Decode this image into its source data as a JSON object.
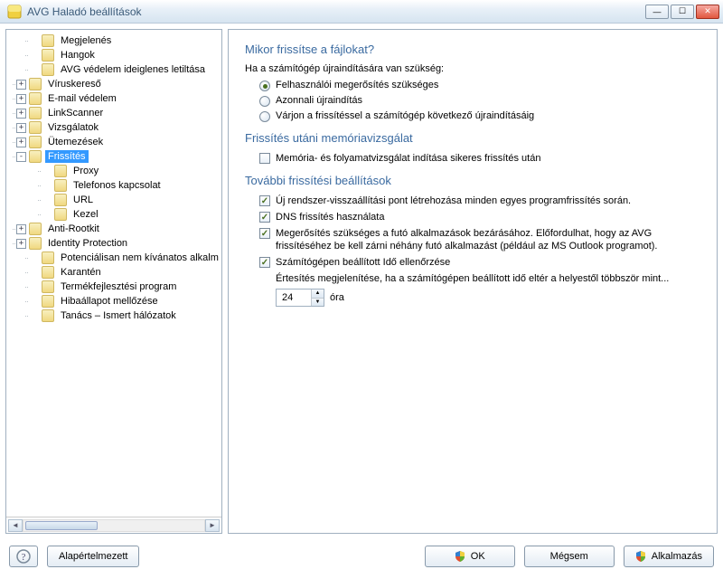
{
  "window": {
    "title": "AVG Haladó beállítások"
  },
  "tree": {
    "items": [
      {
        "indent": 1,
        "exp": "",
        "label": "Megjelenés"
      },
      {
        "indent": 1,
        "exp": "",
        "label": "Hangok"
      },
      {
        "indent": 1,
        "exp": "",
        "label": "AVG védelem ideiglenes letiltása"
      },
      {
        "indent": 0,
        "exp": "+",
        "label": "Víruskereső"
      },
      {
        "indent": 0,
        "exp": "+",
        "label": "E-mail védelem"
      },
      {
        "indent": 0,
        "exp": "+",
        "label": "LinkScanner"
      },
      {
        "indent": 0,
        "exp": "+",
        "label": "Vizsgálatok"
      },
      {
        "indent": 0,
        "exp": "+",
        "label": "Ütemezések"
      },
      {
        "indent": 0,
        "exp": "-",
        "label": "Frissítés",
        "selected": true
      },
      {
        "indent": 2,
        "exp": "",
        "label": "Proxy"
      },
      {
        "indent": 2,
        "exp": "",
        "label": "Telefonos kapcsolat"
      },
      {
        "indent": 2,
        "exp": "",
        "label": "URL"
      },
      {
        "indent": 2,
        "exp": "",
        "label": "Kezel"
      },
      {
        "indent": 0,
        "exp": "+",
        "label": "Anti-Rootkit"
      },
      {
        "indent": 0,
        "exp": "+",
        "label": "Identity Protection"
      },
      {
        "indent": 1,
        "exp": "",
        "label": "Potenciálisan nem kívánatos alkalm"
      },
      {
        "indent": 1,
        "exp": "",
        "label": "Karantén"
      },
      {
        "indent": 1,
        "exp": "",
        "label": "Termékfejlesztési program"
      },
      {
        "indent": 1,
        "exp": "",
        "label": "Hibaállapot mellőzése"
      },
      {
        "indent": 1,
        "exp": "",
        "label": "Tanács – Ismert hálózatok"
      }
    ]
  },
  "main": {
    "section1_title": "Mikor frissítse a fájlokat?",
    "section1_desc": "Ha a számítógép újraindítására van szükség:",
    "radio1": "Felhasználói megerősítés szükséges",
    "radio2": "Azonnali újraindítás",
    "radio3": "Várjon a frissítéssel a számítógép következő újraindításáig",
    "section2_title": "Frissítés utáni memóriavizsgálat",
    "check_mem": "Memória- és folyamatvizsgálat indítása sikeres frissítés után",
    "section3_title": "További frissítési beállítások",
    "check_restore": "Új rendszer-visszaállítási pont létrehozása minden egyes programfrissítés során.",
    "check_dns": "DNS frissítés használata",
    "check_confirm": "Megerősítés szükséges a futó alkalmazások bezárásához. Előfordulhat, hogy az AVG frissítéséhez be kell zárni néhány futó alkalmazást (például az MS Outlook programot).",
    "check_time": "Számítógépen beállított Idő ellenőrzése",
    "time_desc": "Értesítés megjelenítése, ha a számítógépen beállított idő eltér a helyestől többször mint...",
    "time_value": "24",
    "time_unit": "óra"
  },
  "buttons": {
    "help_tip": "?",
    "default": "Alapértelmezett",
    "ok": "OK",
    "cancel": "Mégsem",
    "apply": "Alkalmazás"
  }
}
